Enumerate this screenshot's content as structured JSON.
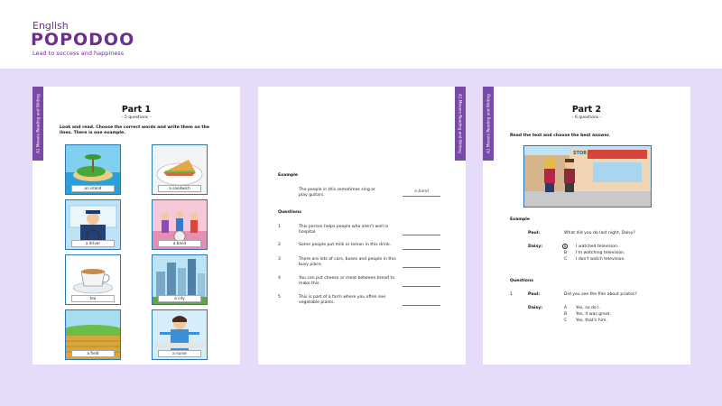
{
  "brand": {
    "line1": "English",
    "name": "POPODOO",
    "tagline": "Lead to success and happiness",
    "color": "#6b2f8c"
  },
  "page1": {
    "side_tab": "A1 Movers Reading and Writing",
    "title": "Part 1",
    "subtitle": "– 5 questions –",
    "instruction": "Look and read. Choose the correct words and write them on the lines. There is one example.",
    "tiles": [
      {
        "label": "an island",
        "icon": "island-image"
      },
      {
        "label": "a sandwich",
        "icon": "sandwich-image"
      },
      {
        "label": "a driver",
        "icon": "driver-image"
      },
      {
        "label": "a band",
        "icon": "band-image"
      },
      {
        "label": "tea",
        "icon": "tea-image"
      },
      {
        "label": "a city",
        "icon": "city-image"
      },
      {
        "label": "a field",
        "icon": "field-image"
      },
      {
        "label": "a nurse",
        "icon": "nurse-image"
      }
    ]
  },
  "page2": {
    "side_tab": "A1 Movers Reading and Writing",
    "example_heading": "Example",
    "example_text": "The people in this sometimes sing or play guitars.",
    "example_answer": "a band",
    "questions_heading": "Questions",
    "questions": [
      {
        "num": "1",
        "text": "This person helps people who aren't well in hospital."
      },
      {
        "num": "2",
        "text": "Some people put milk or lemon in this drink."
      },
      {
        "num": "3",
        "text": "There are lots of cars, buses and people in this busy place."
      },
      {
        "num": "4",
        "text": "You can put cheese or meat between bread to make this."
      },
      {
        "num": "5",
        "text": "This is part of a farm where you often see vegetable plants."
      }
    ]
  },
  "page3": {
    "side_tab": "A1 Movers Reading and Writing",
    "title": "Part 2",
    "subtitle": "– 6 questions –",
    "instruction": "Read the text and choose the best answer.",
    "scene_sign": "STOR",
    "example_heading": "Example",
    "example": {
      "speaker1": "Paul:",
      "line1": "What did you do last night, Daisy?",
      "speaker2": "Daisy:",
      "options": [
        {
          "letter": "A",
          "text": "I watched television."
        },
        {
          "letter": "B",
          "text": "I'm watching television."
        },
        {
          "letter": "C",
          "text": "I don't watch television."
        }
      ]
    },
    "questions_heading": "Questions",
    "q1": {
      "num": "1",
      "speaker1": "Paul:",
      "line1": "Did you see the film about pirates?",
      "speaker2": "Daisy:",
      "options": [
        {
          "letter": "A",
          "text": "Yes, so do I."
        },
        {
          "letter": "B",
          "text": "Yes, it was great."
        },
        {
          "letter": "C",
          "text": "Yes, that's him."
        }
      ]
    }
  }
}
